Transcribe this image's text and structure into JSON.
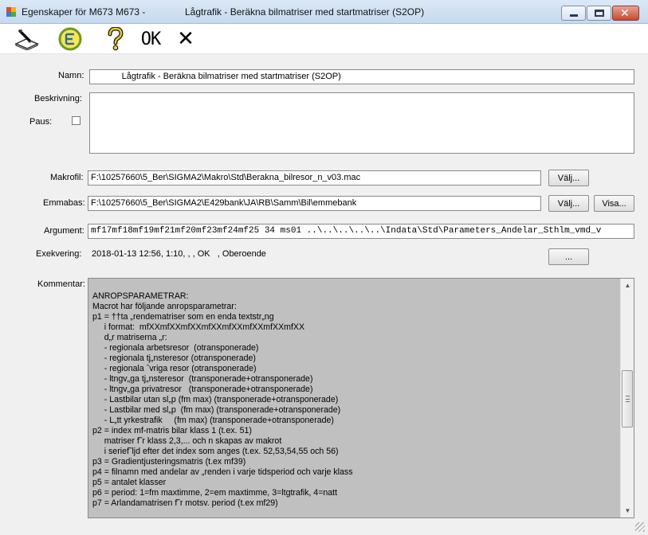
{
  "window": {
    "title": "Egenskaper för M673 M673 -",
    "title_right": "Lågtrafik - Beräkna bilmatriser med startmatriser (S2OP)"
  },
  "toolbar": {
    "ok_label": "OK",
    "cancel_label": "✕"
  },
  "form": {
    "namn_label": "Namn:",
    "namn_value": "            Lågtrafik - Beräkna bilmatriser med startmatriser (S2OP)",
    "beskrivning_label": "Beskrivning:",
    "paus_label": "Paus:",
    "makrofil_label": "Makrofil:",
    "makrofil_value": "F:\\10257660\\5_Ber\\SIGMA2\\Makro\\Std\\Berakna_bilresor_n_v03.mac",
    "emmabas_label": "Emmabas:",
    "emmabas_value": "F:\\10257660\\5_Ber\\SIGMA2\\E429bank\\JA\\RB\\Samm\\Bil\\emmebank",
    "argument_label": "Argument:",
    "argument_value": "mf17mf18mf19mf21mf20mf23mf24mf25 34 ms01 ..\\..\\..\\..\\..\\Indata\\Std\\Parameters_Andelar_Sthlm_vmd_v",
    "exekvering_label": "Exekvering:",
    "exekvering_value": "2018-01-13 12:56, 1:10, , , OK   , Oberoende",
    "kommentar_label": "Kommentar:",
    "valj_label": "Välj...",
    "visa_label": "Visa...",
    "more_label": "..."
  },
  "comment": {
    "lines": [
      "ANROPSPARAMETRAR:",
      "Macrot har följande anropsparametrar:",
      "p1 = ††ta „rendematriser som en enda textstr„ng",
      "     i format:  mfXXmfXXmfXXmfXXmfXXmfXXmfXXmfXX",
      "     d„r matriserna „r:",
      "     - regionala arbetsresor  (otransponerade)",
      "     - regionala tj„nsteresor (otransponerade)",
      "     - regionala ˆvriga resor (otransponerade)",
      "     - ltngv„ga tj„nsteresor  (transponerade+otransponerade)",
      "     - ltngv„ga privatresor   (transponerade+otransponerade)",
      "     - Lastbilar utan sl„p (fm max) (transponerade+otransponerade)",
      "     - Lastbilar med sl„p  (fm max) (transponerade+otransponerade)",
      "     - L„tt yrkestrafik     (fm max) (transponerade+otransponerade)",
      "p2 = index mf-matris bilar klass 1 (t.ex. 51)",
      "     matriser f˜r klass 2,3,... och n skapas av makrot",
      "     i serief˜ljd efter det index som anges (t.ex. 52,53,54,55 och 56)",
      "p3 = Gradientjusteringsmatris (t.ex mf39)",
      "p4 = filnamn med andelar av „renden i varje tidsperiod och varje klass",
      "p5 = antalet klasser",
      "p6 = period: 1=fm maxtimme, 2=em maxtimme, 3=ltgtrafik, 4=natt",
      "p7 = Arlandamatrisen f˜r motsv. period (t.ex mf29)"
    ]
  },
  "icons": {
    "edit": "edit-pen-icon",
    "run": "run-macro-icon",
    "help": "question-mark-icon"
  },
  "colors": {
    "title_bar": "#c6d9ef",
    "comment_bg": "#c0c0c0",
    "close_button": "#c44a30"
  }
}
